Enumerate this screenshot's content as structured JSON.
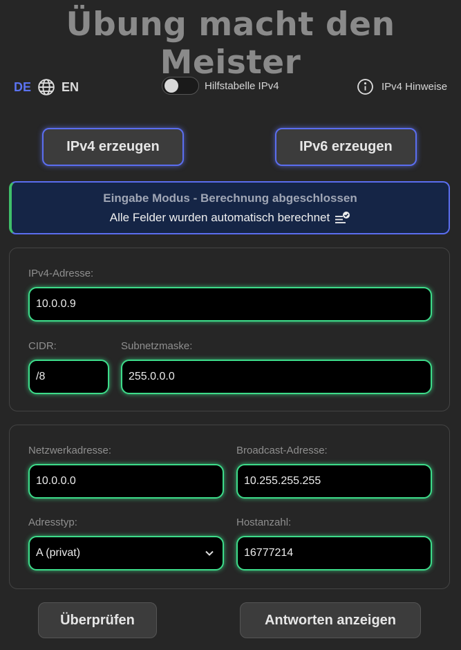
{
  "title": "Übung macht den Meister",
  "lang": {
    "de": "DE",
    "en": "EN"
  },
  "toggle": {
    "label": "Hilfstabelle IPv4",
    "on": false
  },
  "hint": {
    "label": "IPv4 Hinweise"
  },
  "buttons": {
    "ipv4": "IPv4 erzeugen",
    "ipv6": "IPv6 erzeugen",
    "check": "Überprüfen",
    "answers": "Antworten anzeigen"
  },
  "status": {
    "title": "Eingabe Modus - Berechnung abgeschlossen",
    "text": "Alle Felder wurden automatisch berechnet"
  },
  "input_panel": {
    "ip_label": "IPv4-Adresse:",
    "ip_value": "10.0.0.9",
    "cidr_label": "CIDR:",
    "cidr_value": "/8",
    "mask_label": "Subnetzmaske:",
    "mask_value": "255.0.0.0"
  },
  "result_panel": {
    "network_label": "Netzwerkadresse:",
    "network_value": "10.0.0.0",
    "broadcast_label": "Broadcast-Adresse:",
    "broadcast_value": "10.255.255.255",
    "type_label": "Adresstyp:",
    "type_value": "A (privat)",
    "hosts_label": "Hostanzahl:",
    "hosts_value": "16777214"
  },
  "colors": {
    "accent": "#5b6ef0",
    "field_glow": "#3ddc8a",
    "status_bg": "#152546"
  }
}
